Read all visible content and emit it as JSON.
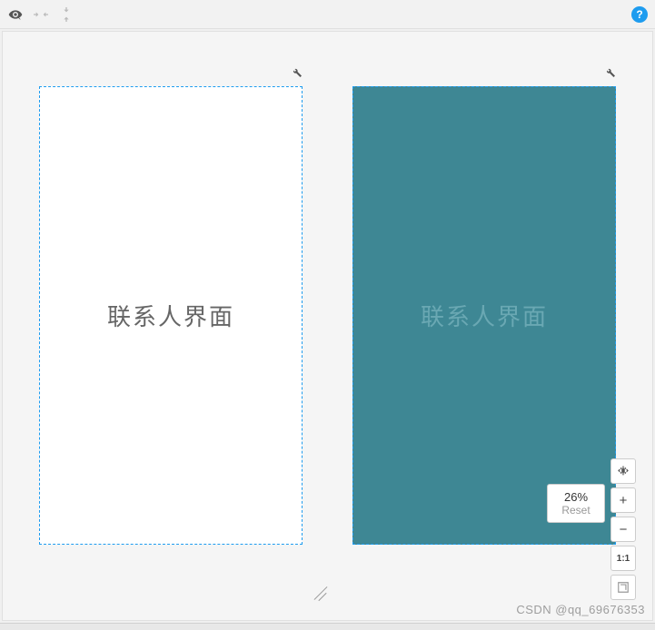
{
  "toolbar": {
    "icons": {
      "eye": "eye-icon",
      "horizontal": "resize-horizontal-icon",
      "vertical": "resize-vertical-icon",
      "help": "?"
    }
  },
  "panes": {
    "left": {
      "text": "联系人界面",
      "background": "#ffffff"
    },
    "right": {
      "text": "联系人界面",
      "background": "#3e8794"
    }
  },
  "zoom": {
    "percent": "26%",
    "reset_label": "Reset",
    "ratio_label": "1:1",
    "plus": "+",
    "minus": "−"
  },
  "watermark": "CSDN @qq_69676353"
}
